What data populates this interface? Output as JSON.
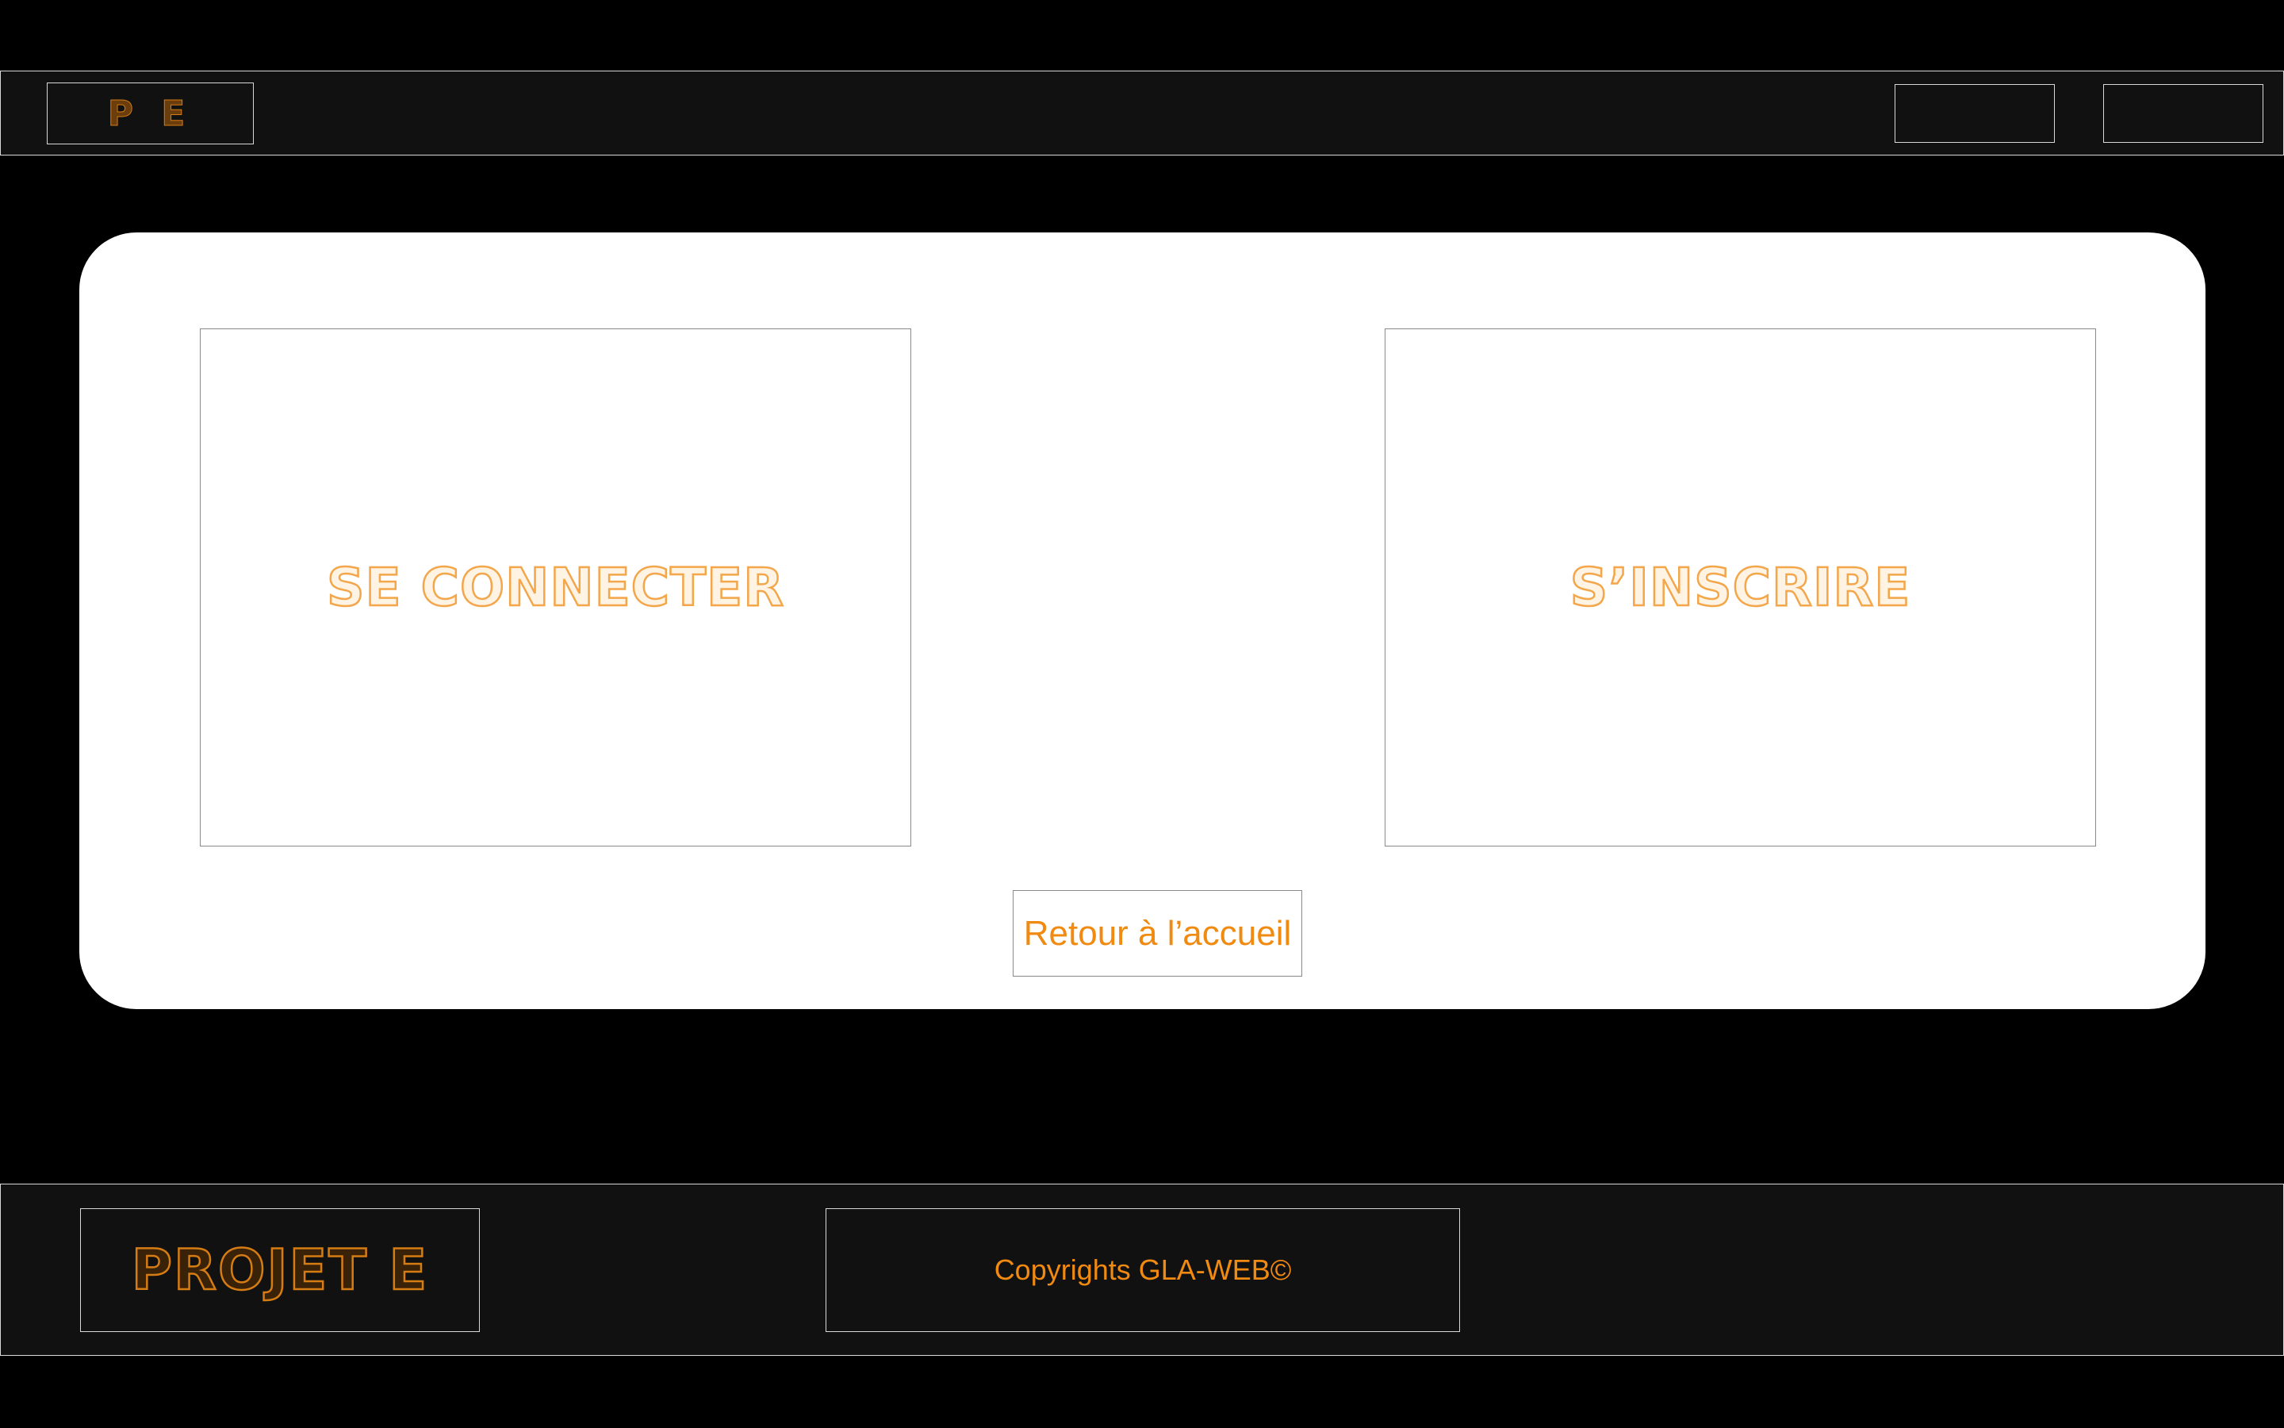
{
  "header": {
    "logo_text": "P E",
    "nav_buttons": [
      "",
      ""
    ]
  },
  "main": {
    "login_label": "SE CONNECTER",
    "register_label": "S’INSCRIRE",
    "home_button_label": "Retour à l’accueil"
  },
  "footer": {
    "logo_text": "PROJET E",
    "copyright": "Copyrights GLA-WEB©"
  },
  "colors": {
    "background": "#000000",
    "bar_background": "#111111",
    "card_background": "#ffffff",
    "accent_orange": "#f08a10",
    "border_light": "#d9d9d9"
  }
}
